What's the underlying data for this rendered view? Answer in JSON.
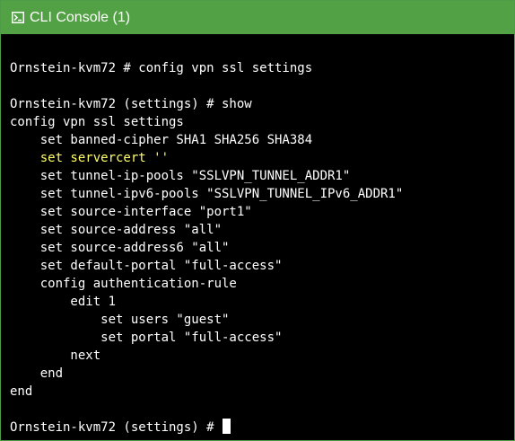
{
  "window": {
    "title": "CLI Console (1)",
    "title_icon": "terminal-icon",
    "accent_color": "#53a145"
  },
  "console": {
    "background": "#000000",
    "text_color": "#ffffff",
    "highlight_color": "#ffff66",
    "lines": [
      {
        "text": "",
        "highlight": false
      },
      {
        "text": "Ornstein-kvm72 # config vpn ssl settings",
        "highlight": false
      },
      {
        "text": "",
        "highlight": false
      },
      {
        "text": "Ornstein-kvm72 (settings) # show",
        "highlight": false
      },
      {
        "text": "config vpn ssl settings",
        "highlight": false
      },
      {
        "text": "    set banned-cipher SHA1 SHA256 SHA384",
        "highlight": false
      },
      {
        "text": "    set servercert ''",
        "highlight": true
      },
      {
        "text": "    set tunnel-ip-pools \"SSLVPN_TUNNEL_ADDR1\"",
        "highlight": false
      },
      {
        "text": "    set tunnel-ipv6-pools \"SSLVPN_TUNNEL_IPv6_ADDR1\"",
        "highlight": false
      },
      {
        "text": "    set source-interface \"port1\"",
        "highlight": false
      },
      {
        "text": "    set source-address \"all\"",
        "highlight": false
      },
      {
        "text": "    set source-address6 \"all\"",
        "highlight": false
      },
      {
        "text": "    set default-portal \"full-access\"",
        "highlight": false
      },
      {
        "text": "    config authentication-rule",
        "highlight": false
      },
      {
        "text": "        edit 1",
        "highlight": false
      },
      {
        "text": "            set users \"guest\"",
        "highlight": false
      },
      {
        "text": "            set portal \"full-access\"",
        "highlight": false
      },
      {
        "text": "        next",
        "highlight": false
      },
      {
        "text": "    end",
        "highlight": false
      },
      {
        "text": "end",
        "highlight": false
      },
      {
        "text": "",
        "highlight": false
      }
    ],
    "prompt": "Ornstein-kvm72 (settings) # "
  }
}
